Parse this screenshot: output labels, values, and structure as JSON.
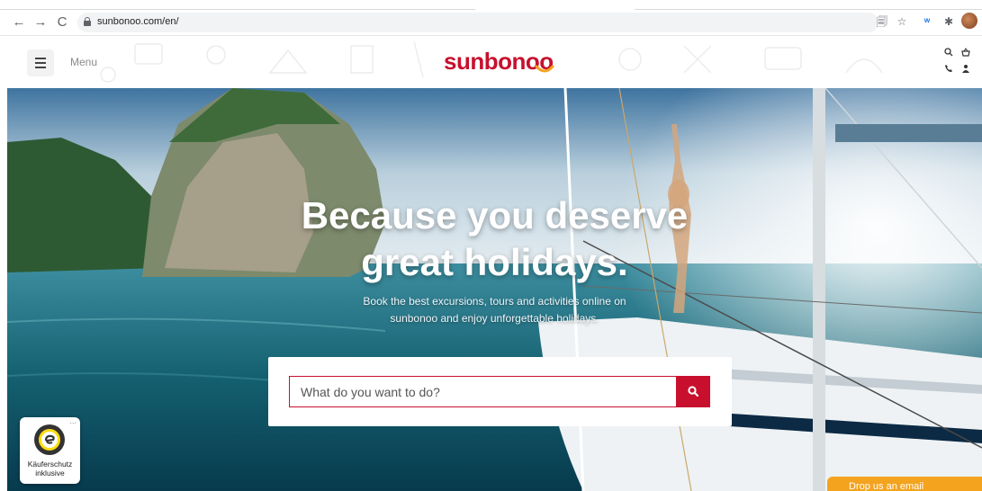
{
  "browser": {
    "url": "sunbonoo.com/en/",
    "back_icon": "←",
    "forward_icon": "→",
    "reload_icon": "C",
    "translate_icon": "🗐",
    "star_icon": "☆",
    "ext_icon": "ʷ",
    "puzzle_icon": "✱"
  },
  "header": {
    "menu_label": "Menu",
    "logo_text": "sunbonoo",
    "brand_color": "#c8102e"
  },
  "hero": {
    "title_line1": "Because you deserve",
    "title_line2": "great holidays.",
    "subtitle_line1": "Book the best excursions, tours and activities online on",
    "subtitle_line2": "sunbonoo and enjoy unforgettable holidays."
  },
  "search": {
    "placeholder": "What do you want to do?"
  },
  "trust_badge": {
    "line1": "Käuferschutz",
    "line2": "inklusive",
    "more": "..."
  },
  "feedback": {
    "label": "Drop us an email"
  },
  "colors": {
    "accent": "#c8102e",
    "feedback_orange": "#f4a31e"
  }
}
